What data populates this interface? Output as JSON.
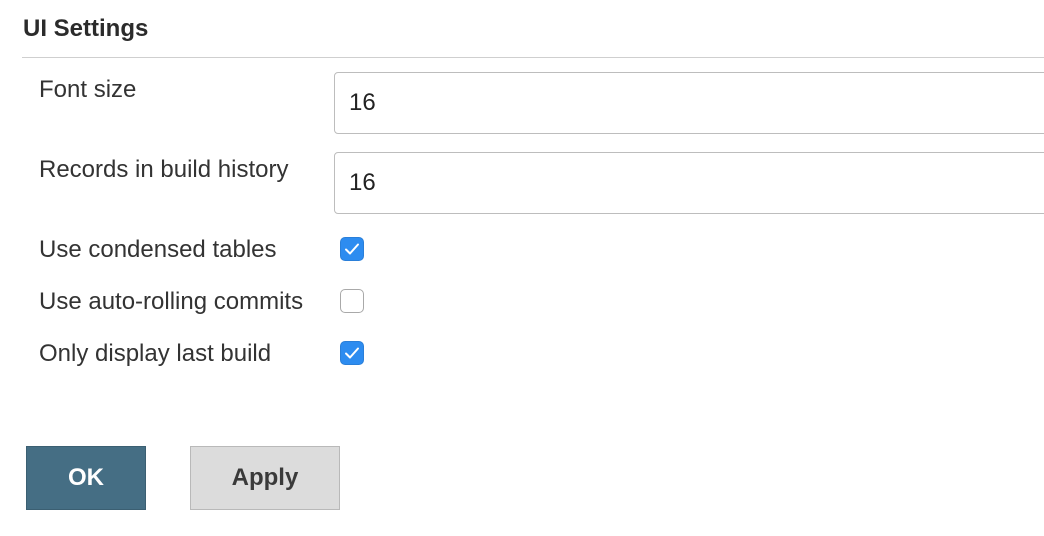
{
  "section": {
    "title": "UI Settings"
  },
  "fields": {
    "font_size": {
      "label": "Font size",
      "value": "16"
    },
    "records_in_build_history": {
      "label": "Records in build history",
      "value": "16"
    }
  },
  "checkboxes": [
    {
      "label": "Use condensed tables",
      "checked": true
    },
    {
      "label": "Use auto-rolling commits",
      "checked": false
    },
    {
      "label": "Only display last build",
      "checked": true
    }
  ],
  "buttons": {
    "ok_label": "OK",
    "apply_label": "Apply"
  },
  "colors": {
    "checkbox_accent": "#2d8cf0",
    "ok_button": "#456e84",
    "apply_button": "#dcdcdc"
  }
}
